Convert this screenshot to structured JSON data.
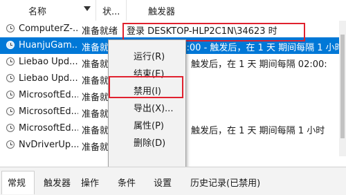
{
  "columns": {
    "name": "名称",
    "status": "状...",
    "trigger": "触发器"
  },
  "tasks": [
    {
      "name": "ComputerZ-...",
      "status": "准备就绪",
      "trigger": "登录 DESKTOP-HLP2C1N\\34623 时"
    },
    {
      "name": "HuanjuGam...",
      "status": "准备就绪",
      "trigger": "在每天的 下午 8:00 - 触发后，在 1 天 期间每隔 1 小时"
    },
    {
      "name": "Liebao Upd...",
      "status": "准备就绪",
      "trigger": "触发后，在 1 天 期间每隔 02:00:"
    },
    {
      "name": "Liebao Upd...",
      "status": "准备就绪",
      "trigger": ""
    },
    {
      "name": "MicrosoftEd...",
      "status": "准备就绪",
      "trigger": ""
    },
    {
      "name": "MicrosoftEd...",
      "status": "准备就绪",
      "trigger": ""
    },
    {
      "name": "MicrosoftEd...",
      "status": "准备就绪",
      "trigger": "触发后，在 1 天 期间每隔 1 小时"
    },
    {
      "name": "NvDriverUp...",
      "status": "准备就绪",
      "trigger": ""
    }
  ],
  "context_menu": [
    "运行(R)",
    "结束(E)",
    "禁用(I)",
    "导出(X)...",
    "属性(P)",
    "删除(D)"
  ],
  "tabs": [
    "常规",
    "触发器",
    "操作",
    "条件",
    "设置",
    "历史记录(已禁用)"
  ],
  "colors": {
    "selection": "#0078d7",
    "highlight": "#e0212e"
  }
}
